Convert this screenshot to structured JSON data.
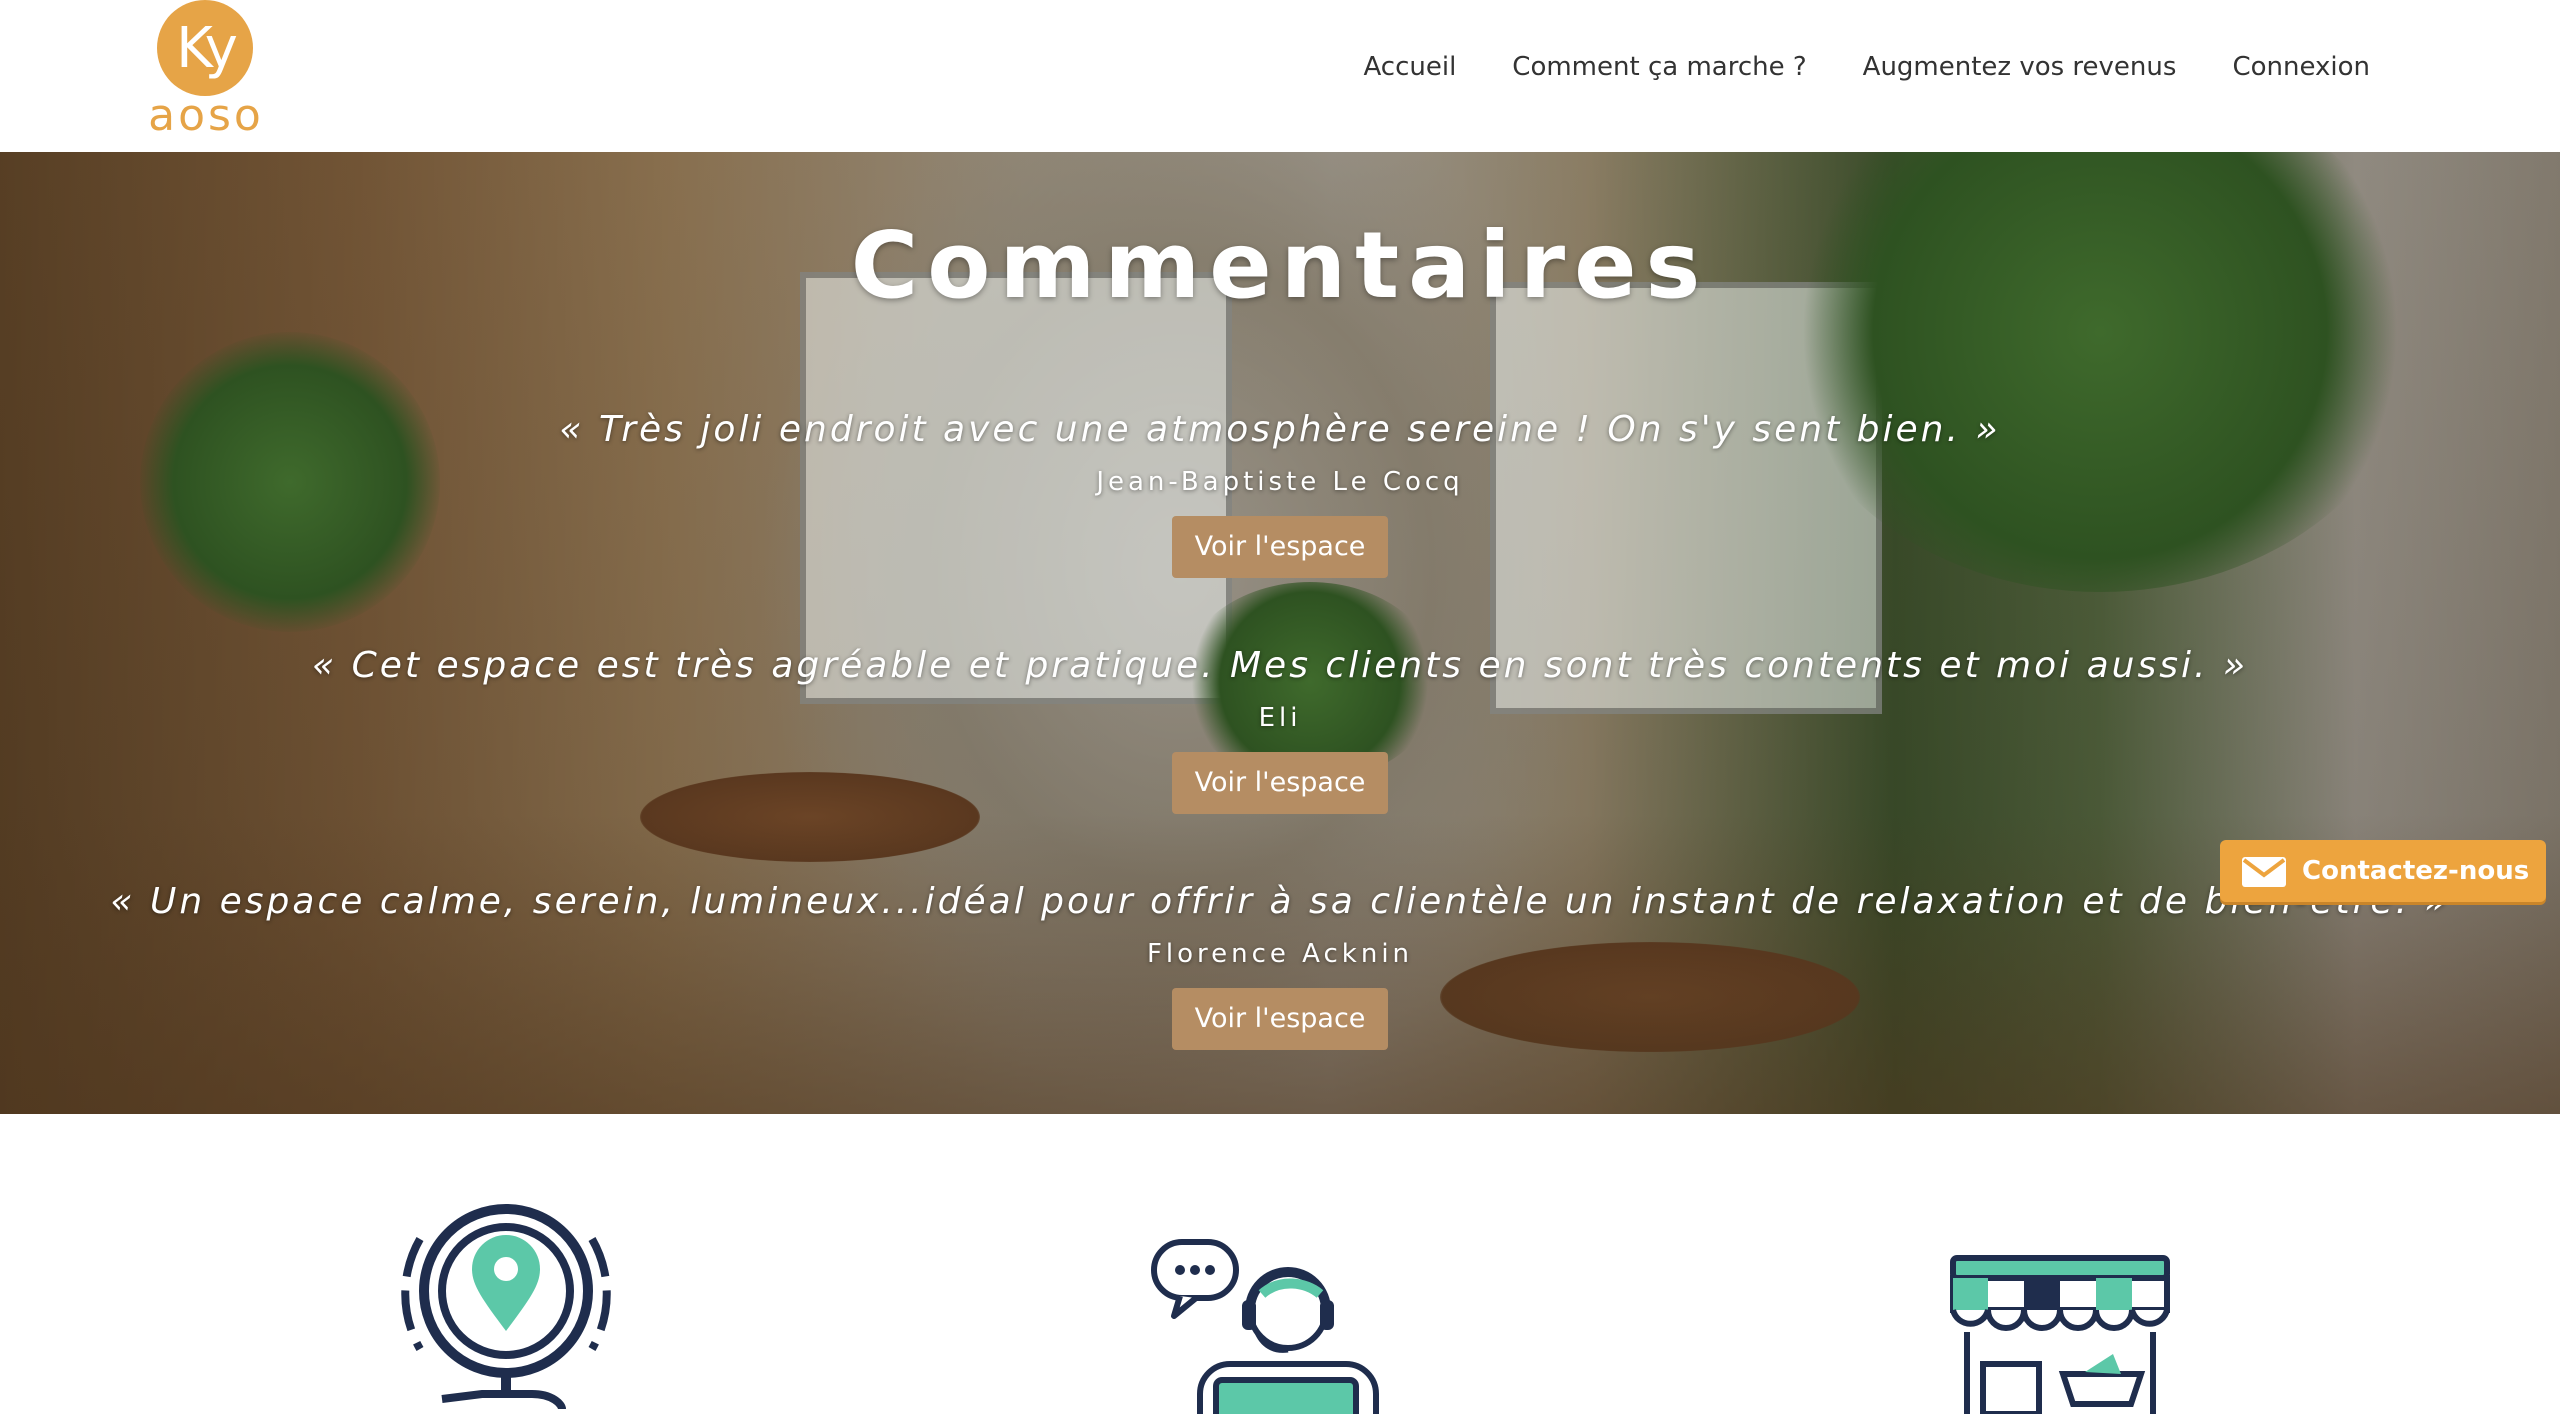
{
  "header": {
    "logo": {
      "initials": "Ky",
      "word": "aoso"
    },
    "nav": [
      "Accueil",
      "Comment ça marche ?",
      "Augmentez vos revenus",
      "Connexion"
    ]
  },
  "hero": {
    "title": "Commentaires",
    "testimonials": [
      {
        "quote": "« Très joli endroit avec une atmosphère sereine ! On s'y sent bien. »",
        "author": "Jean-Baptiste Le Cocq",
        "button": "Voir l'espace"
      },
      {
        "quote": "« Cet espace est très agréable et pratique. Mes clients en sont très contents et moi aussi. »",
        "author": "Eli",
        "button": "Voir l'espace"
      },
      {
        "quote": "« Un espace calme, serein, lumineux...idéal pour offrir à sa clientèle un instant de relaxation et de bien-être. »",
        "author": "Florence Acknin",
        "button": "Voir l'espace"
      }
    ]
  },
  "contact": {
    "label": "Contactez-nous",
    "icon": "envelope-icon"
  },
  "features": {
    "icons": [
      "location-pin-icon",
      "support-agent-icon",
      "shop-storefront-icon"
    ]
  },
  "colors": {
    "brand": "#e6a447",
    "button": "#b58d63",
    "contact": "#eda43e",
    "icon_navy": "#1f2d4d",
    "icon_teal": "#5cc8a8"
  }
}
